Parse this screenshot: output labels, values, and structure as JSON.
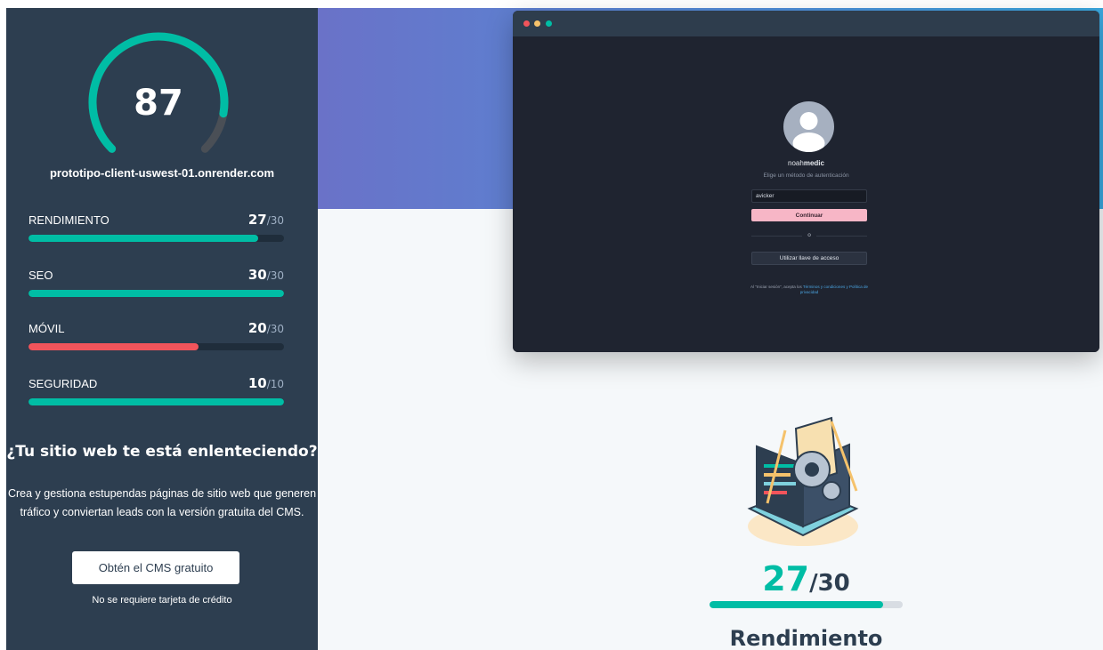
{
  "sidebar": {
    "overall_score": "87",
    "overall_score_value": 87,
    "domain": "prototipo-client-uswest-01.onrender.com",
    "metrics": [
      {
        "label": "RENDIMIENTO",
        "score": "27",
        "max": "/30",
        "value": 27,
        "max_value": 30,
        "color": "#00bda5"
      },
      {
        "label": "SEO",
        "score": "30",
        "max": "/30",
        "value": 30,
        "max_value": 30,
        "color": "#00bda5"
      },
      {
        "label": "MÓVIL",
        "score": "20",
        "max": "/30",
        "value": 20,
        "max_value": 30,
        "color": "#f2545b"
      },
      {
        "label": "SEGURIDAD",
        "score": "10",
        "max": "/10",
        "value": 10,
        "max_value": 10,
        "color": "#00bda5"
      }
    ],
    "promo_title": "¿Tu sitio web te está enlenteciendo?",
    "promo_text": "Crea y gestiona estupendas páginas de sitio web que generen tráfico y conviertan leads con la versión gratuita del CMS.",
    "cta_label": "Obtén el CMS gratuito",
    "cta_note": "No se requiere tarjeta de crédito"
  },
  "browser": {
    "dot_colors": [
      "#f2545b",
      "#f5c26b",
      "#00bda5"
    ],
    "brand_prefix": "noah",
    "brand_bold": "medic",
    "subtitle": "Elige un método de autenticación",
    "input_value": "avicker",
    "continue_label": "Continuar",
    "or_label": "o",
    "passkey_label": "Utilizar llave de acceso",
    "terms_prefix": "Al \"Iniciar sesión\", acepta los ",
    "terms_link": "Términos y condiciones y Política de privacidad"
  },
  "section": {
    "score": "27",
    "max": "/30",
    "value": 27,
    "max_value": 30,
    "title": "Rendimiento"
  },
  "colors": {
    "accent": "#00bda5",
    "danger": "#f2545b",
    "sidebar_bg": "#2d3e50"
  }
}
